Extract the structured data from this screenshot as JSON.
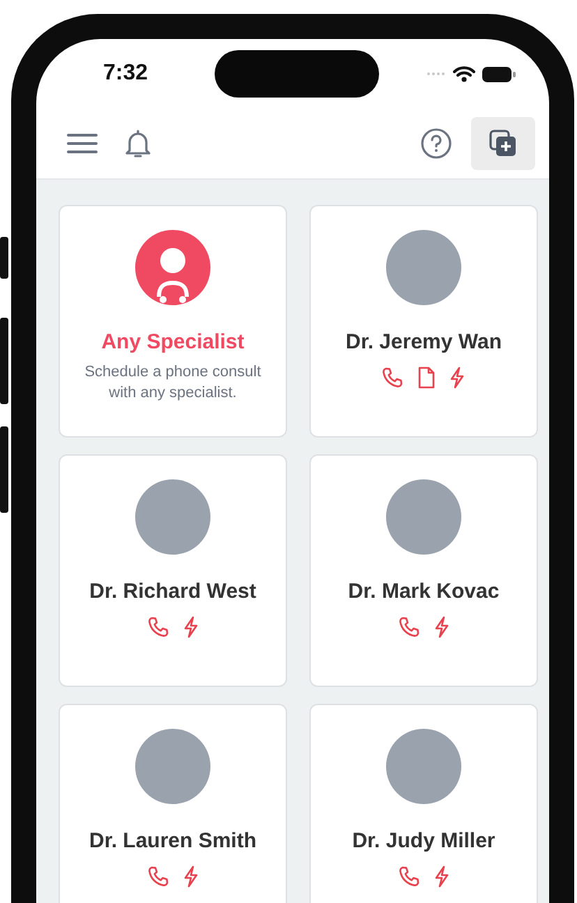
{
  "status_bar": {
    "time": "7:32"
  },
  "cards": [
    {
      "kind": "any",
      "title": "Any Specialist",
      "description": "Schedule a phone consult with any specialist."
    },
    {
      "kind": "doctor",
      "name": "Dr. Jeremy Wan",
      "phone": true,
      "document": true,
      "flash": true
    },
    {
      "kind": "doctor",
      "name": "Dr. Richard West",
      "phone": true,
      "document": false,
      "flash": true
    },
    {
      "kind": "doctor",
      "name": "Dr. Mark Kovac",
      "phone": true,
      "document": false,
      "flash": true
    },
    {
      "kind": "doctor",
      "name": "Dr. Lauren Smith",
      "phone": true,
      "document": false,
      "flash": true
    },
    {
      "kind": "doctor",
      "name": "Dr. Judy Miller",
      "phone": true,
      "document": false,
      "flash": true
    }
  ]
}
